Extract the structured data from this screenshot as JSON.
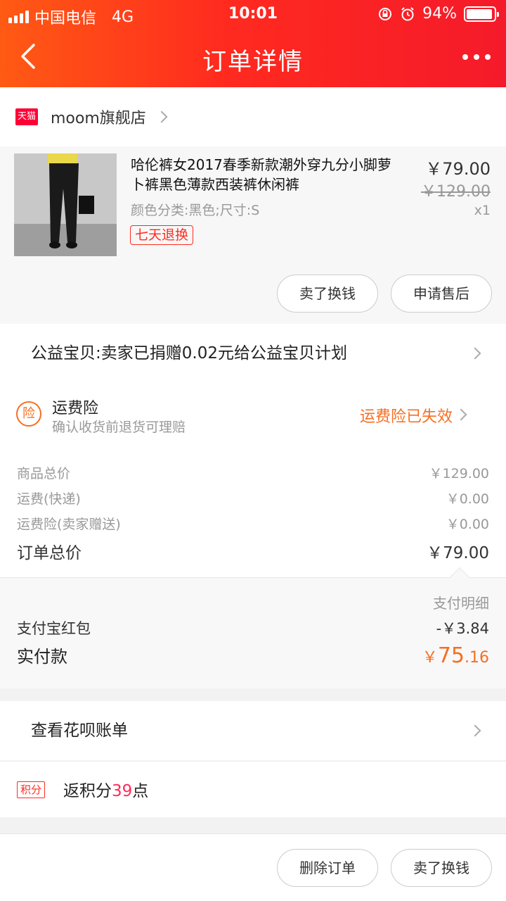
{
  "status_bar": {
    "carrier": "中国电信",
    "network": "4G",
    "time": "10:01",
    "battery": "94%",
    "battery_level": 0.94
  },
  "nav": {
    "title": "订单详情"
  },
  "shop": {
    "badge": "天猫",
    "name": "moom旗舰店"
  },
  "product": {
    "title": "哈伦裤女2017春季新款潮外穿九分小脚萝卜裤黑色薄款西装裤休闲裤",
    "spec": "颜色分类:黑色;尺寸:S",
    "tag": "七天退换",
    "price": "￥79.00",
    "original_price": "￥129.00",
    "quantity": "x1",
    "actions": [
      "卖了换钱",
      "申请售后"
    ]
  },
  "charity": {
    "text": "公益宝贝:卖家已捐赠0.02元给公益宝贝计划"
  },
  "insurance": {
    "icon_char": "险",
    "title": "运费险",
    "subtitle": "确认收货前退货可理赔",
    "status": "运费险已失效"
  },
  "price_summary": {
    "rows": [
      {
        "label": "商品总价",
        "value": "￥129.00"
      },
      {
        "label": "运费(快递)",
        "value": "￥0.00"
      },
      {
        "label": "运费险(卖家赠送)",
        "value": "￥0.00"
      }
    ],
    "total_label": "订单总价",
    "total_value": "￥79.00"
  },
  "payment": {
    "detail_label": "支付明细",
    "discount_label": "支付宝红包",
    "discount_value": "-￥3.84",
    "paid_label": "实付款",
    "paid_currency": "￥",
    "paid_int": "75",
    "paid_dec": ".16"
  },
  "huabei": {
    "text": "查看花呗账单"
  },
  "points": {
    "badge": "积分",
    "prefix": "返积分",
    "number": "39",
    "suffix": "点"
  },
  "bottom_actions": [
    "删除订单",
    "卖了换钱"
  ],
  "colors": {
    "header_start": "#ff5a14",
    "header_end": "#f51a2a",
    "accent_red": "#ff2b1f",
    "accent_orange": "#f66e22"
  }
}
